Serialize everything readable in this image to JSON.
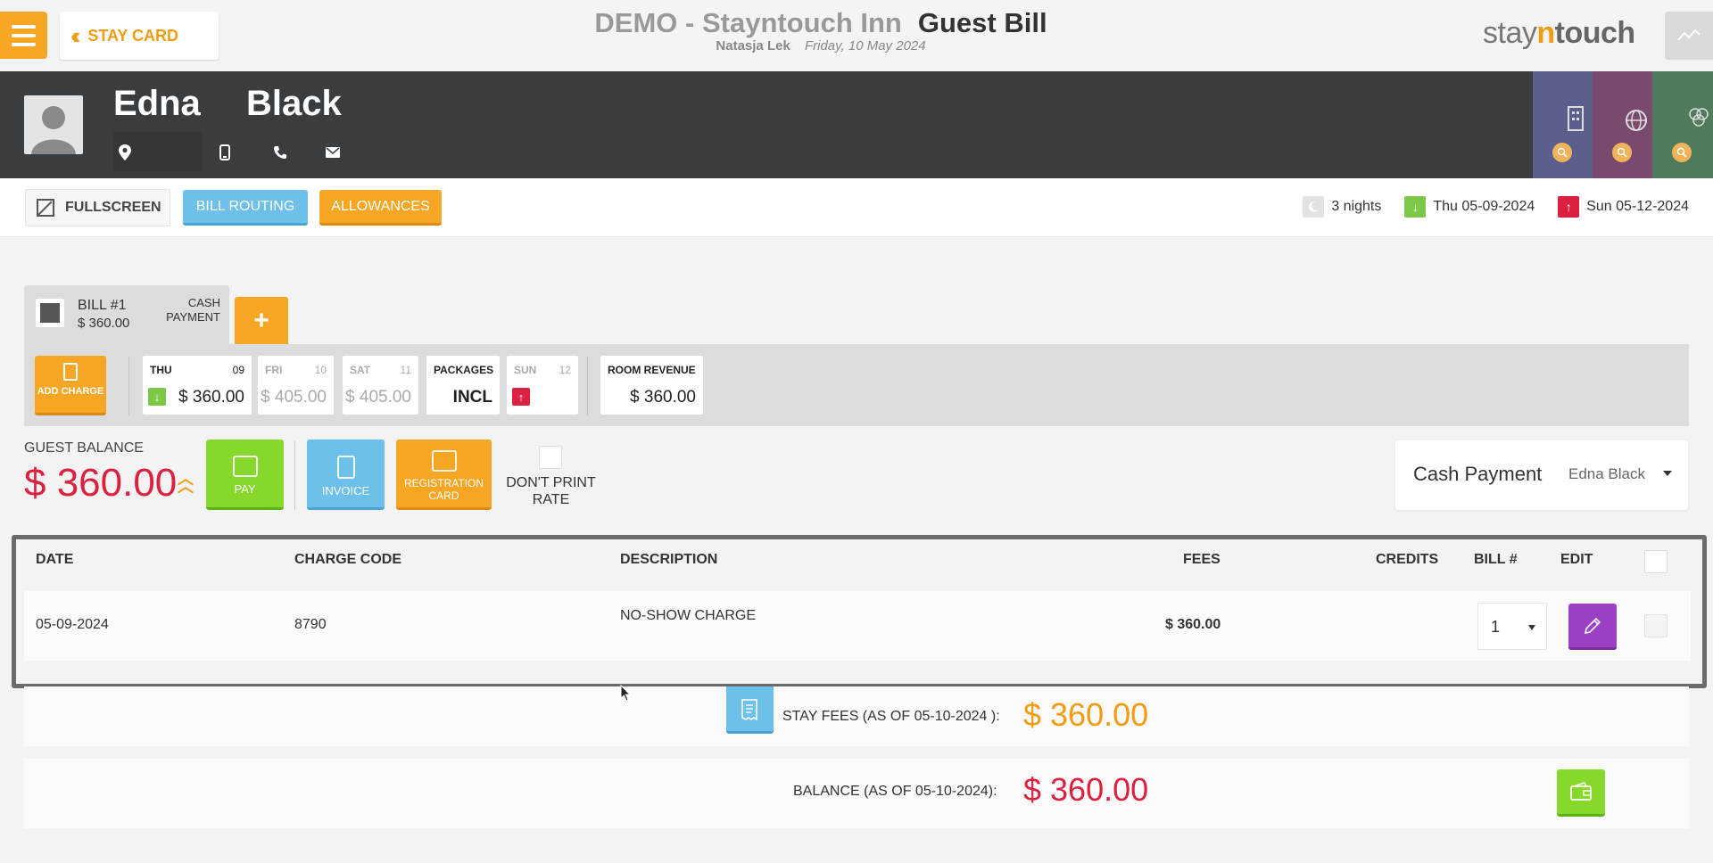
{
  "topbar": {
    "stay_card_label": "STAY CARD",
    "hotel_name": "DEMO - Stayntouch Inn",
    "page_title": "Guest Bill",
    "user_name": "Natasja Lek",
    "business_date": "Friday, 10 May 2024",
    "logo": {
      "part1": "stay",
      "part2": "n",
      "part3": "touch"
    }
  },
  "guest": {
    "first_name": "Edna",
    "last_name": "Black"
  },
  "actions": {
    "fullscreen_label": "FULLSCREEN",
    "bill_routing_label": "BILL ROUTING",
    "allowances_label": "ALLOWANCES"
  },
  "stay": {
    "nights": "3 nights",
    "arrival": "Thu 05-09-2024",
    "departure": "Sun 05-12-2024"
  },
  "bill_tab": {
    "bill_number": "BILL #1",
    "amount": "$ 360.00",
    "payment_type": "CASH PAYMENT",
    "add_bill_label": "+"
  },
  "nights_strip": {
    "add_charge_label": "ADD CHARGE",
    "days": [
      {
        "day": "THU",
        "date": "09",
        "value": "$ 360.00"
      },
      {
        "day": "FRI",
        "date": "10",
        "value": "$ 405.00"
      },
      {
        "day": "SAT",
        "date": "11",
        "value": "$ 405.00"
      }
    ],
    "packages": {
      "label": "PACKAGES",
      "value": "INCL"
    },
    "departure_day": {
      "day": "SUN",
      "date": "12"
    },
    "room_revenue": {
      "label": "ROOM REVENUE",
      "value": "$ 360.00"
    }
  },
  "balance": {
    "label": "GUEST BALANCE",
    "amount": "$ 360.00",
    "pay_label": "PAY",
    "invoice_label": "INVOICE",
    "registration_label": "REGISTRATION CARD",
    "dont_print_rate_label": "DON'T PRINT RATE",
    "payment_panel_title": "Cash Payment",
    "payment_panel_guest": "Edna Black"
  },
  "table": {
    "headers": {
      "date": "DATE",
      "charge_code": "CHARGE CODE",
      "description": "DESCRIPTION",
      "fees": "FEES",
      "credits": "CREDITS",
      "bill_no": "BILL #",
      "edit": "EDIT"
    },
    "rows": [
      {
        "date": "05-09-2024",
        "charge_code": "8790",
        "description": "NO-SHOW CHARGE",
        "fees": "$ 360.00",
        "credits": "",
        "bill_no": "1"
      }
    ]
  },
  "summary": {
    "stay_fees_label": "STAY FEES (AS OF  05-10-2024 ):",
    "stay_fees_value": "$ 360.00",
    "balance_label": "BALANCE (AS OF  05-10-2024):",
    "balance_value": "$ 360.00"
  },
  "colors": {
    "orange": "#f6a623",
    "blue": "#6cc0ea",
    "green": "#86d92a",
    "purple": "#9b3fc4",
    "red": "#dc2140",
    "dark_header": "#3a3d40"
  }
}
